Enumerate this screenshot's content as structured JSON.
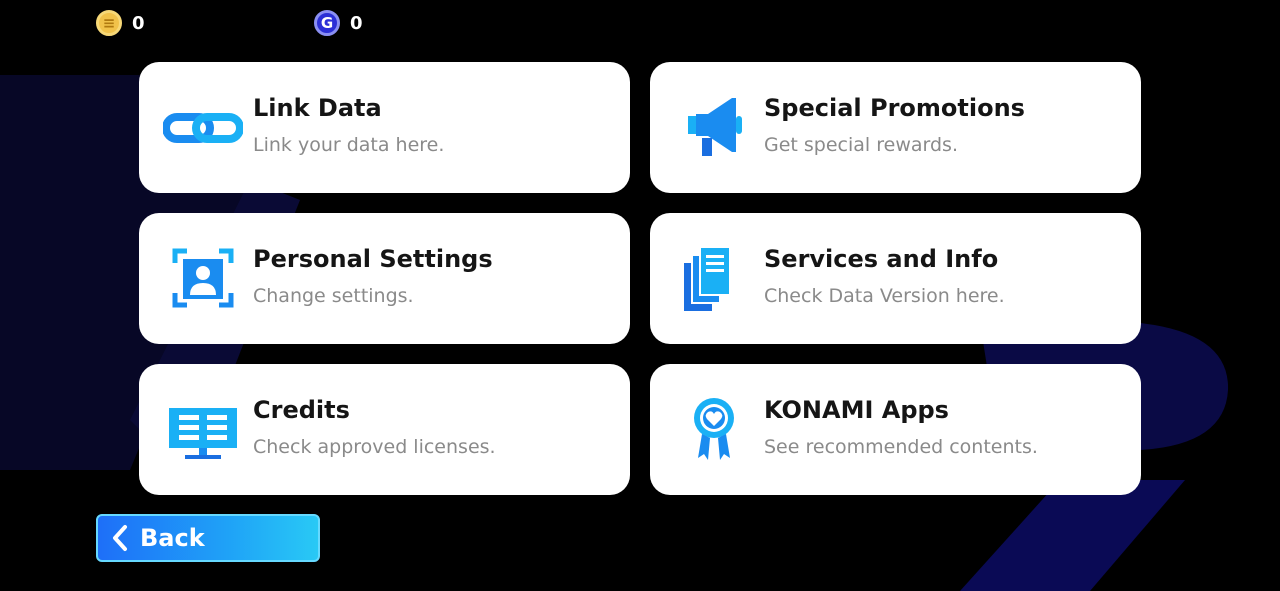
{
  "currencies": [
    {
      "icon": "e-coin-icon",
      "amount": "0"
    },
    {
      "icon": "g-coin-icon",
      "amount": "0"
    }
  ],
  "menu": [
    {
      "icon": "link-icon",
      "title": "Link Data",
      "subtitle": "Link your data here."
    },
    {
      "icon": "megaphone-icon",
      "title": "Special Promotions",
      "subtitle": "Get special rewards."
    },
    {
      "icon": "person-frame-icon",
      "title": "Personal Settings",
      "subtitle": "Change settings."
    },
    {
      "icon": "documents-icon",
      "title": "Services and Info",
      "subtitle": "Check Data Version here."
    },
    {
      "icon": "monitor-icon",
      "title": "Credits",
      "subtitle": "Check approved licenses."
    },
    {
      "icon": "heart-badge-icon",
      "title": "KONAMI Apps",
      "subtitle": "See recommended contents."
    }
  ],
  "back": {
    "label": "Back",
    "icon": "chevron-left-icon"
  },
  "colors": {
    "accent": "#1e8cf5",
    "background": "#000000",
    "card": "#ffffff"
  }
}
